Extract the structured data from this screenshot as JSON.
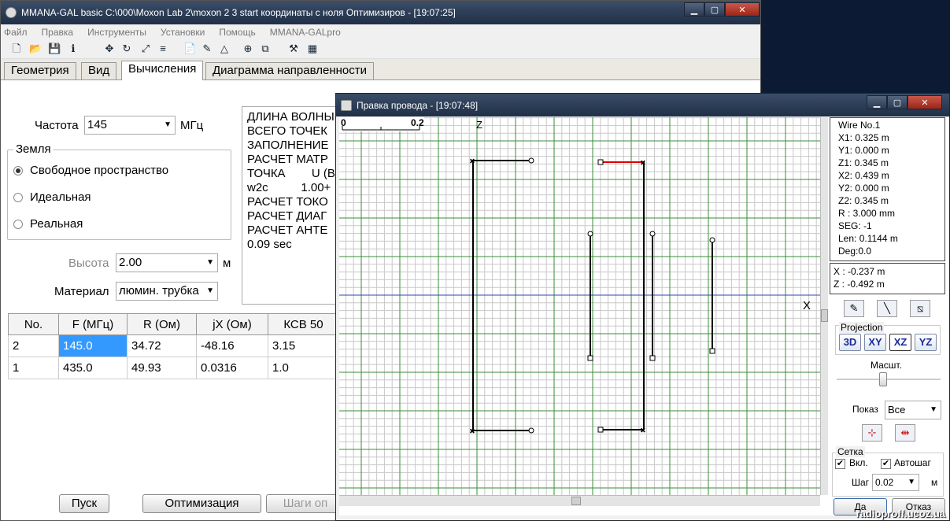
{
  "main": {
    "title": "MMANA-GAL basic C:\\000\\Moxon Lab 2\\moxon 2 3 start координаты с ноля Оптимизиров - [19:07:25]",
    "menu": [
      "Файл",
      "Правка",
      "Инструменты",
      "Установки",
      "Помощь",
      "MMANA-GALpro"
    ],
    "tabs": [
      "Геометрия",
      "Вид",
      "Вычисления",
      "Диаграмма направленности"
    ],
    "frequency": {
      "label": "Частота",
      "value": "145",
      "unit": "МГц"
    },
    "ground": {
      "title": "Земля",
      "options": [
        "Свободное пространство",
        "Идеальная",
        "Реальная"
      ]
    },
    "height": {
      "label": "Высота",
      "value": "2.00",
      "unit": "м"
    },
    "material": {
      "label": "Материал",
      "value": "люмин. трубка"
    },
    "log_lines": [
      "ДЛИНА ВОЛНЫ",
      "ВСЕГО ТОЧЕК",
      "ЗАПОЛНЕНИЕ",
      "РАСЧЕТ МАТР",
      "ТОЧКА        U (В",
      "w2c          1.00+",
      "РАСЧЕТ ТОКО",
      "РАСЧЕТ ДИАГ",
      "РАСЧЕТ АНТЕ",
      "0.09 sec"
    ],
    "table": {
      "headers": [
        "No.",
        "F (МГц)",
        "R (Ом)",
        "jX (Ом)",
        "КСВ 50"
      ],
      "rows": [
        [
          "2",
          "145.0",
          "34.72",
          "-48.16",
          "3.15"
        ],
        [
          "1",
          "435.0",
          "49.93",
          "0.0316",
          "1.0"
        ]
      ]
    },
    "buttons": {
      "start": "Пуск",
      "optimize": "Оптимизация",
      "steps": "Шаги оп"
    }
  },
  "dialog": {
    "title": "Правка провода - [19:07:48]",
    "scale": {
      "start": "0",
      "end": "0.2",
      "axis": "Z",
      "xaxis": "X"
    },
    "wire_info": [
      "Wire No.1",
      "X1: 0.325 m",
      "Y1: 0.000 m",
      "Z1: 0.345 m",
      "X2: 0.439 m",
      "Y2: 0.000 m",
      "Z2: 0.345 m",
      "R : 3.000 mm",
      "SEG: -1",
      "Len: 0.1144 m",
      "Deg:0.0"
    ],
    "cursor": [
      "X : -0.237 m",
      "Z : -0.492 m"
    ],
    "projection": {
      "title": "Projection",
      "buttons": [
        "3D",
        "XY",
        "XZ",
        "YZ"
      ]
    },
    "scale_label": "Масшт.",
    "show": {
      "label": "Показ",
      "value": "Все"
    },
    "grid_group": {
      "title": "Сетка",
      "on_label": "Вкл.",
      "auto_label": "Автошаг",
      "step_label": "Шаг",
      "step_value": "0.02",
      "unit": "м"
    },
    "buttons": {
      "ok": "Да",
      "cancel": "Отказ"
    }
  },
  "watermark": "radioproff.ucoz.ua",
  "colors": {
    "grid_minor": "#c8c8c8",
    "grid_major": "#3a8c3a",
    "axis": "#3344aa",
    "selected_wire": "#dd0000"
  }
}
